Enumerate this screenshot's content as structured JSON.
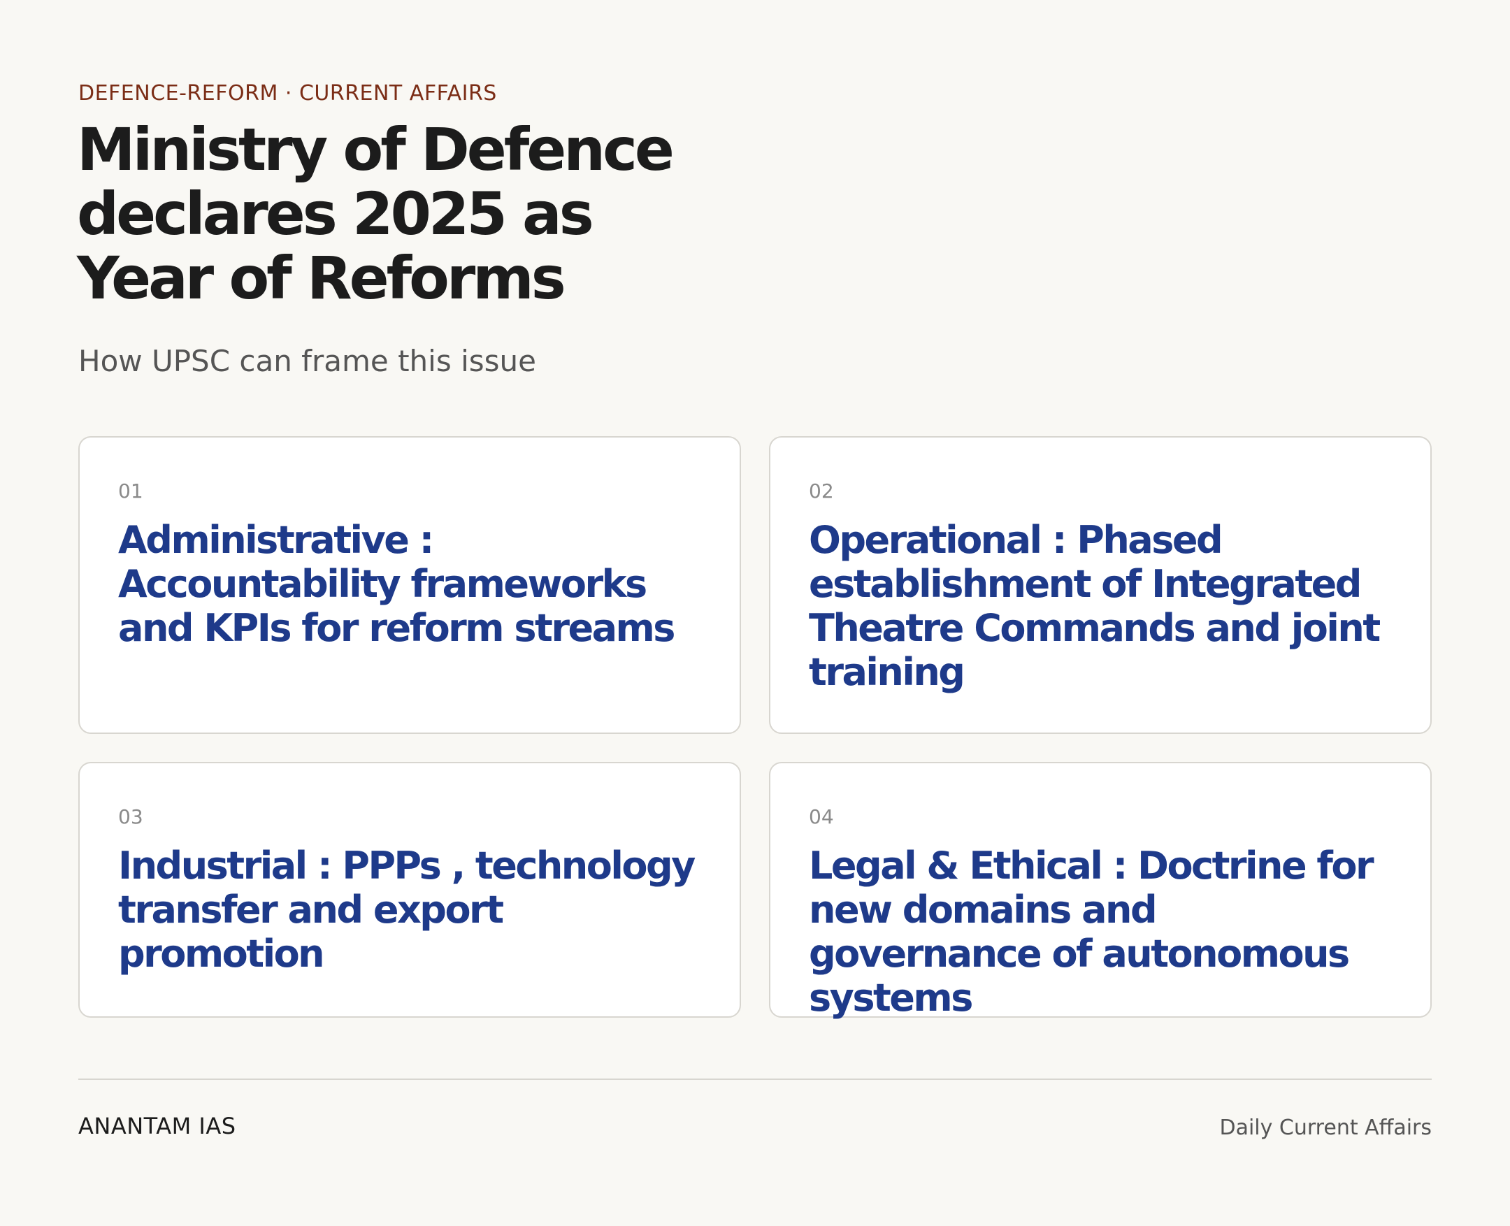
{
  "header": {
    "kicker": "DEFENCE-REFORM · CURRENT AFFAIRS",
    "title": "Ministry of Defence declares 2025 as Year of Reforms",
    "subtitle": "How UPSC can frame this issue"
  },
  "cards": [
    {
      "num": "01",
      "title": "Administrative : Accountability frameworks and KPIs for reform streams"
    },
    {
      "num": "02",
      "title": "Operational : Phased establishment of Integrated Theatre Commands and joint training"
    },
    {
      "num": "03",
      "title": "Industrial : PPPs , technology transfer and export promotion"
    },
    {
      "num": "04",
      "title": "Legal & Ethical : Doctrine for new domains and governance of autonomous systems"
    }
  ],
  "footer": {
    "brand": "ANANTAM IAS",
    "tagline": "Daily Current Affairs"
  },
  "colors": {
    "background": "#f9f8f4",
    "kicker": "#7b2d16",
    "card_title": "#1e3a8a",
    "title": "#1c1c1c"
  }
}
